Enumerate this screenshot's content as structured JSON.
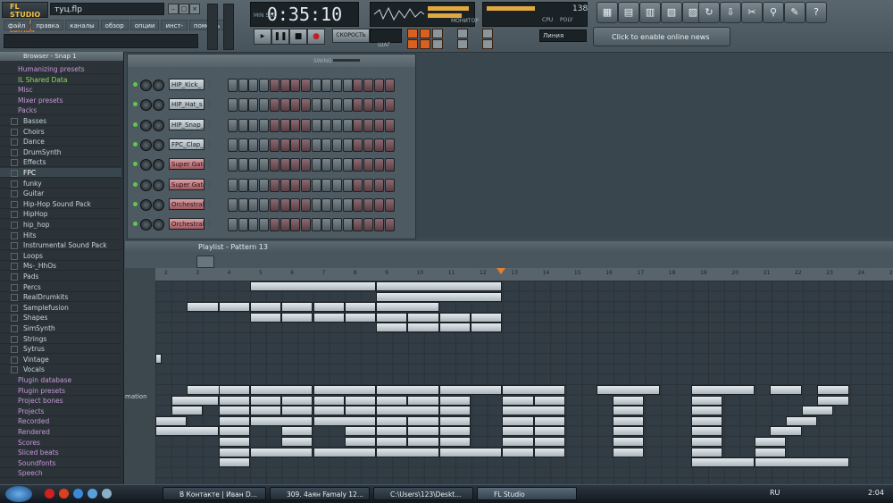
{
  "app": {
    "logo_line1": "FL STUDIO",
    "logo_line2": "PRODUCER EDITION",
    "filename": "туц.flp"
  },
  "menu": [
    "файл",
    "правка",
    "каналы",
    "обзор",
    "опции",
    "инст-ты",
    "помощь"
  ],
  "transport": {
    "time": "0:35:10",
    "time_label": "MIN SEC",
    "play": "▶",
    "pause": "❚❚",
    "stop": "■",
    "rec": "●",
    "song_label": "СКОРОСТЬ",
    "pattern_label": "ШАГ",
    "snap": "Линия",
    "cpu_label": "CPU",
    "poly_label": "POLY",
    "tempo": "138",
    "monitor_label": "МОНИТОР"
  },
  "news": "Click to enable online news",
  "browser": {
    "title": "Browser - Snap 1",
    "items": [
      {
        "label": "Humanizing presets",
        "type": "folder"
      },
      {
        "label": "IL Shared Data",
        "type": "green"
      },
      {
        "label": "Misc",
        "type": "folder"
      },
      {
        "label": "Mixer presets",
        "type": "folder"
      },
      {
        "label": "Packs",
        "type": "folder"
      },
      {
        "label": "Basses",
        "type": "sub"
      },
      {
        "label": "Choirs",
        "type": "sub"
      },
      {
        "label": "Dance",
        "type": "sub"
      },
      {
        "label": "DrumSynth",
        "type": "sub"
      },
      {
        "label": "Effects",
        "type": "sub"
      },
      {
        "label": "FPC",
        "type": "sub-sel"
      },
      {
        "label": "funky",
        "type": "sub"
      },
      {
        "label": "Guitar",
        "type": "sub"
      },
      {
        "label": "Hip-Hop Sound Pack",
        "type": "sub"
      },
      {
        "label": "HipHop",
        "type": "sub"
      },
      {
        "label": "hip_hop",
        "type": "sub"
      },
      {
        "label": "Hits",
        "type": "sub"
      },
      {
        "label": "Instrumental Sound Pack",
        "type": "sub"
      },
      {
        "label": "Loops",
        "type": "sub"
      },
      {
        "label": "Ms-_HhOs",
        "type": "sub"
      },
      {
        "label": "Pads",
        "type": "sub"
      },
      {
        "label": "Percs",
        "type": "sub"
      },
      {
        "label": "RealDrumkits",
        "type": "sub"
      },
      {
        "label": "Samplefusion",
        "type": "sub"
      },
      {
        "label": "Shapes",
        "type": "sub"
      },
      {
        "label": "SimSynth",
        "type": "sub"
      },
      {
        "label": "Strings",
        "type": "sub"
      },
      {
        "label": "Sytrus",
        "type": "sub"
      },
      {
        "label": "Vintage",
        "type": "sub"
      },
      {
        "label": "Vocals",
        "type": "sub"
      },
      {
        "label": "Plugin database",
        "type": "folder"
      },
      {
        "label": "Plugin presets",
        "type": "folder"
      },
      {
        "label": "Project bones",
        "type": "folder"
      },
      {
        "label": "Projects",
        "type": "folder"
      },
      {
        "label": "Recorded",
        "type": "folder"
      },
      {
        "label": "Rendered",
        "type": "folder"
      },
      {
        "label": "Scores",
        "type": "folder"
      },
      {
        "label": "Sliced beats",
        "type": "folder"
      },
      {
        "label": "Soundfonts",
        "type": "folder"
      },
      {
        "label": "Speech",
        "type": "folder"
      }
    ]
  },
  "channels": [
    {
      "name": "HIP_Kick_",
      "color": "grey"
    },
    {
      "name": "HIP_Hat_s",
      "color": "grey"
    },
    {
      "name": "HIP_Snap_",
      "color": "grey"
    },
    {
      "name": "FPC_Clap_",
      "color": "grey"
    },
    {
      "name": "Super Gate",
      "color": "red"
    },
    {
      "name": "Super Gate",
      "color": "red"
    },
    {
      "name": "Orchestral",
      "color": "red"
    },
    {
      "name": "Orchestral",
      "color": "red"
    }
  ],
  "stepseq": {
    "swing_label": "SWING"
  },
  "playlist": {
    "title": "Playlist - Pattern 13",
    "automation_label": "mation",
    "ruler": [
      "2",
      "3",
      "4",
      "5",
      "6",
      "7",
      "8",
      "9",
      "10",
      "11",
      "12",
      "13",
      "14",
      "15",
      "16",
      "17",
      "18",
      "19",
      "20",
      "21",
      "22",
      "23",
      "24",
      "25"
    ]
  },
  "taskbar": {
    "tasks": [
      "В Контакте | Иван D...",
      "309. 4аян Famaly 12...",
      "C:\\Users\\123\\Deskt...",
      "FL Studio"
    ],
    "lang": "RU",
    "clock": "2:04"
  }
}
